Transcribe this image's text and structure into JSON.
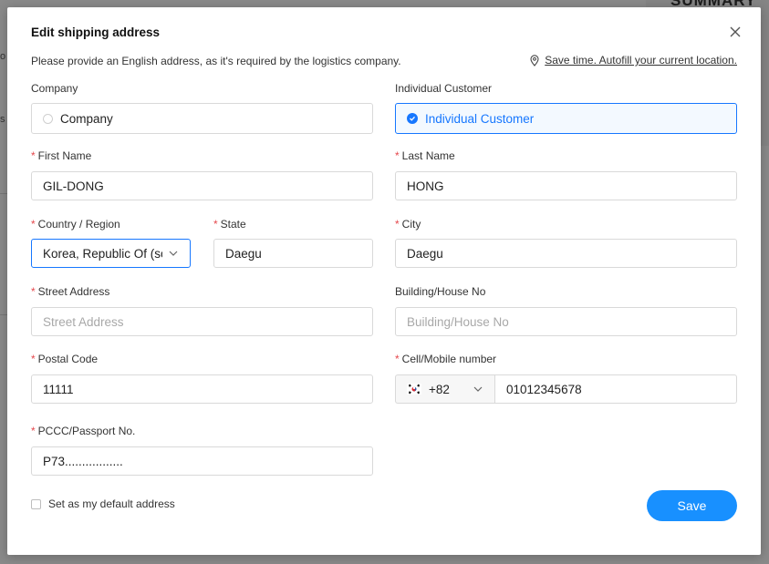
{
  "background": {
    "summary_label": "SUMMARY"
  },
  "modal": {
    "title": "Edit shipping address",
    "notice": "Please provide an English address, as it's required by the logistics company.",
    "autofill_link": "Save time. Autofill your current location.",
    "customer_type": {
      "company_header": "Company",
      "individual_header": "Individual Customer",
      "company_option": "Company",
      "individual_option": "Individual Customer",
      "selected": "Individual Customer"
    },
    "fields": {
      "first_name": {
        "label": "First Name",
        "value": "GIL-DONG"
      },
      "last_name": {
        "label": "Last Name",
        "value": "HONG"
      },
      "country": {
        "label": "Country / Region",
        "value": "Korea, Republic Of (south Korea)"
      },
      "state": {
        "label": "State",
        "value": "Daegu"
      },
      "city": {
        "label": "City",
        "value": "Daegu"
      },
      "street": {
        "label": "Street Address",
        "placeholder": "Street Address"
      },
      "building": {
        "label": "Building/House No",
        "placeholder": "Building/House No"
      },
      "postal": {
        "label": "Postal Code",
        "value": "11111"
      },
      "phone": {
        "label": "Cell/Mobile number",
        "country_code": "+82",
        "value": "01012345678"
      },
      "passport": {
        "label": "PCCC/Passport No.",
        "value": "P73................."
      }
    },
    "default_address_label": "Set as my default address",
    "save_label": "Save"
  },
  "colors": {
    "accent": "#1890ff",
    "required": "#e5484d",
    "overlay": "#8e8e8e"
  }
}
